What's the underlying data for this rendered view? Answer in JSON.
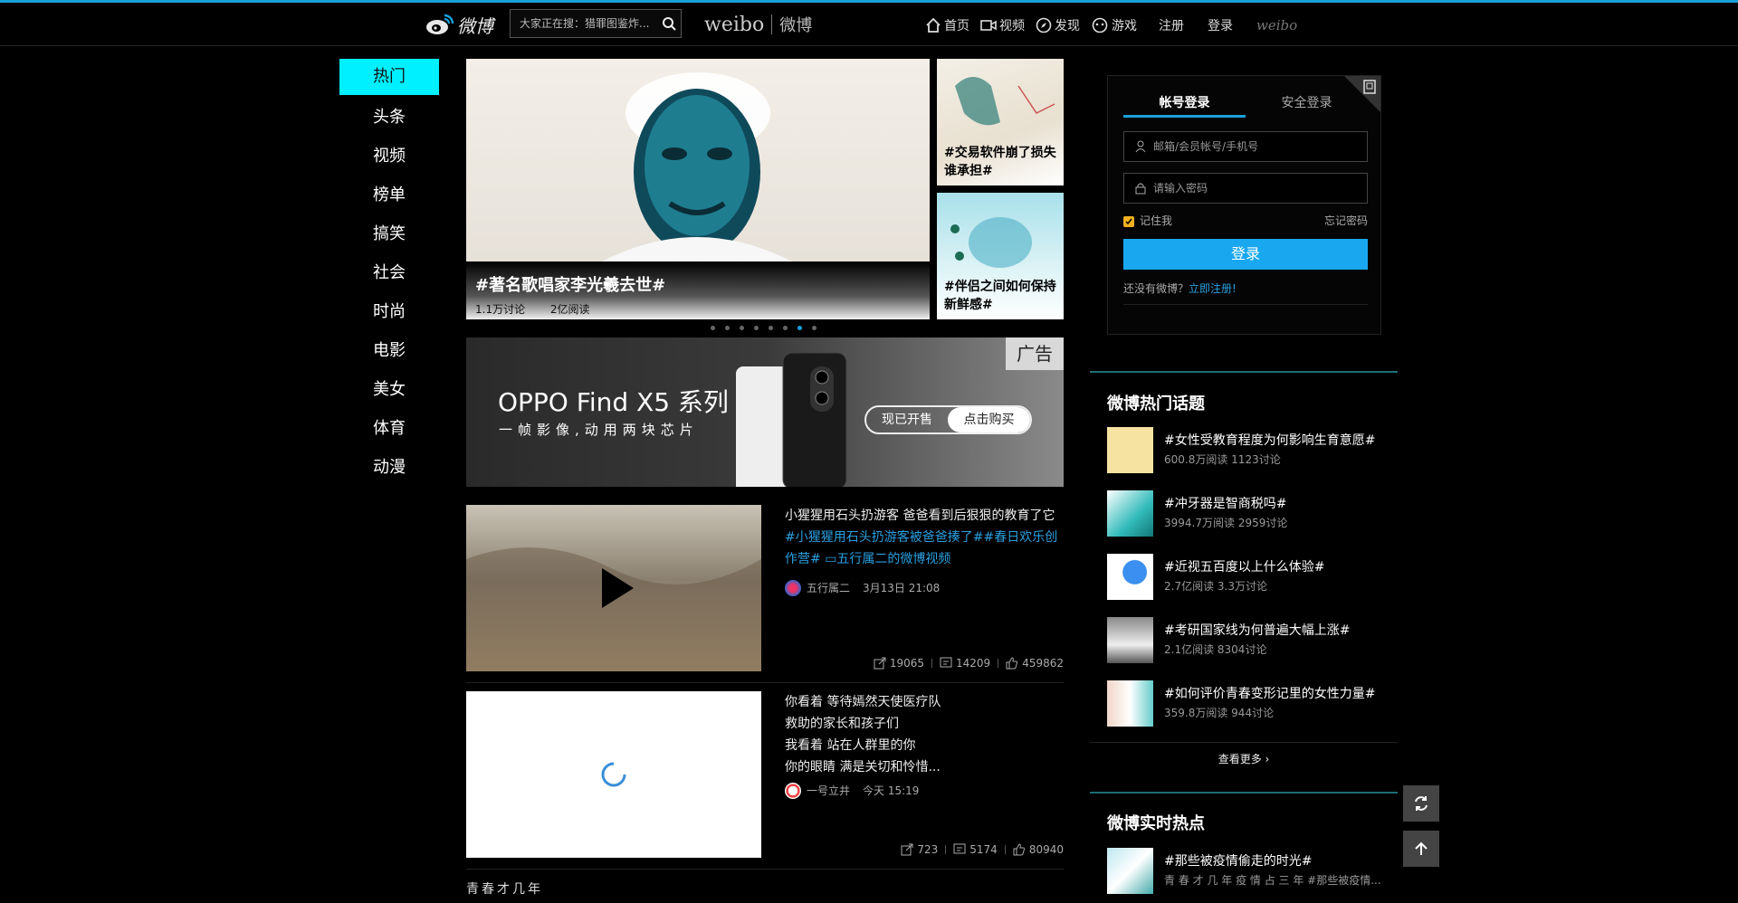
{
  "header": {
    "logo_text": "微博",
    "search_placeholder": "大家正在搜：猎罪图鉴炸...",
    "brand_en": "weibo",
    "brand_cn": "微博",
    "nav": [
      {
        "label": "首页",
        "icon": "home-icon"
      },
      {
        "label": "视频",
        "icon": "video-icon"
      },
      {
        "label": "发现",
        "icon": "compass-icon"
      },
      {
        "label": "游戏",
        "icon": "gamepad-icon"
      }
    ],
    "register": "注册",
    "login": "登录",
    "weibo_mark": "weibo"
  },
  "sidebar": {
    "items": [
      "热门",
      "头条",
      "视频",
      "榜单",
      "搞笑",
      "社会",
      "时尚",
      "电影",
      "美女",
      "体育",
      "动漫"
    ],
    "active_index": 0
  },
  "carousel": {
    "main": {
      "title": "#著名歌唱家李光羲去世#",
      "discussions": "1.1万讨论",
      "reads": "2亿阅读"
    },
    "side": [
      {
        "title": "#交易软件崩了损失谁承担#"
      },
      {
        "title": "#伴侣之间如何保持新鲜感#"
      }
    ],
    "dot_count": 8,
    "active_dot": 6
  },
  "ad": {
    "tag": "广告",
    "title": "OPPO Find X5 系列",
    "subtitle": "一帧影像,动用两块芯片",
    "btn_left": "现已开售",
    "btn_right": "点击购买"
  },
  "feed": [
    {
      "text": "小猩猩用石头扔游客 爸爸看到后狠狠的教育了它",
      "tags": "#小猩猩用石头扔游客被爸爸揍了##春日欢乐创作营# ",
      "video_link": "五行属二的微博视频",
      "author": "五行属二",
      "time": "3月13日 21:08",
      "shares": "19065",
      "comments": "14209",
      "likes": "459862"
    },
    {
      "lines": [
        "你看着 等待嫣然天使医疗队",
        "救助的家长和孩子们",
        "我看着 站在人群里的你",
        "你的眼睛 满是关切和怜惜..."
      ],
      "author": "一号立井",
      "time": "今天 15:19",
      "shares": "723",
      "comments": "5174",
      "likes": "80940"
    }
  ],
  "bottom_text": "青春才几年",
  "login": {
    "tab_account": "帐号登录",
    "tab_secure": "安全登录",
    "username_placeholder": "邮箱/会员帐号/手机号",
    "password_placeholder": "请输入密码",
    "remember": "记住我",
    "forgot": "忘记密码",
    "button": "登录",
    "no_account": "还没有微博？",
    "register_link": "立即注册!"
  },
  "hot_topics": {
    "title": "微博热门话题",
    "items": [
      {
        "name": "#女性受教育程度为何影响生育意愿#",
        "meta": "600.8万阅读 1123讨论"
      },
      {
        "name": "#冲牙器是智商税吗#",
        "meta": "3994.7万阅读 2959讨论"
      },
      {
        "name": "#近视五百度以上什么体验#",
        "meta": "2.7亿阅读 3.3万讨论"
      },
      {
        "name": "#考研国家线为何普遍大幅上涨#",
        "meta": "2.1亿阅读 8304讨论"
      },
      {
        "name": "#如何评价青春变形记里的女性力量#",
        "meta": "359.8万阅读 944讨论"
      }
    ],
    "see_more": "查看更多 ›"
  },
  "realtime": {
    "title": "微博实时热点",
    "items": [
      {
        "name": "#那些被疫情偷走的时光#",
        "meta": "青 春 才 几 年 疫 情 占 三 年 #那些被疫情..."
      }
    ]
  },
  "colors": {
    "accent": "#1aa0d8",
    "active_nav": "#00f0ff",
    "login_button": "#19a8f0",
    "link": "#2a9fe0"
  }
}
